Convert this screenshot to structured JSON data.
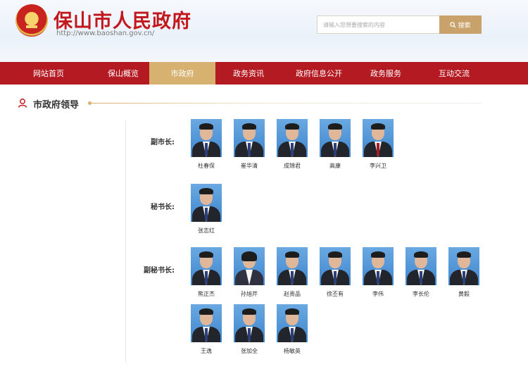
{
  "header": {
    "title": "保山市人民政府",
    "url": "http://www.baoshan.gov.cn/",
    "search_placeholder": "请输入您想要搜索的内容",
    "search_button": "搜索"
  },
  "nav": {
    "items": [
      {
        "label": "网站首页"
      },
      {
        "label": "保山概览"
      },
      {
        "label": "市政府"
      },
      {
        "label": "政务资讯"
      },
      {
        "label": "政府信息公开"
      },
      {
        "label": "政务服务"
      },
      {
        "label": "互动交流"
      }
    ],
    "active_index": 2
  },
  "section": {
    "title": "市政府领导"
  },
  "groups": {
    "vice_mayors": {
      "label": "副市长:",
      "people": [
        "杜春保",
        "崔华清",
        "成锦君",
        "高康",
        "李兴卫"
      ]
    },
    "secretary_general": {
      "label": "秘书长:",
      "people": [
        "张志红"
      ]
    },
    "deputy_secretaries": {
      "label": "副秘书长:",
      "people": [
        "熊正杰",
        "孙旭芹",
        "赵贵品",
        "徐丕有",
        "李伟",
        "李长伦",
        "黄毅",
        "王逸",
        "张加全",
        "杨敏英"
      ]
    }
  },
  "colors": {
    "brand_red": "#b41a22",
    "nav_active": "#d7b170",
    "title_red": "#c1171d",
    "search_button": "#c8a26a"
  }
}
